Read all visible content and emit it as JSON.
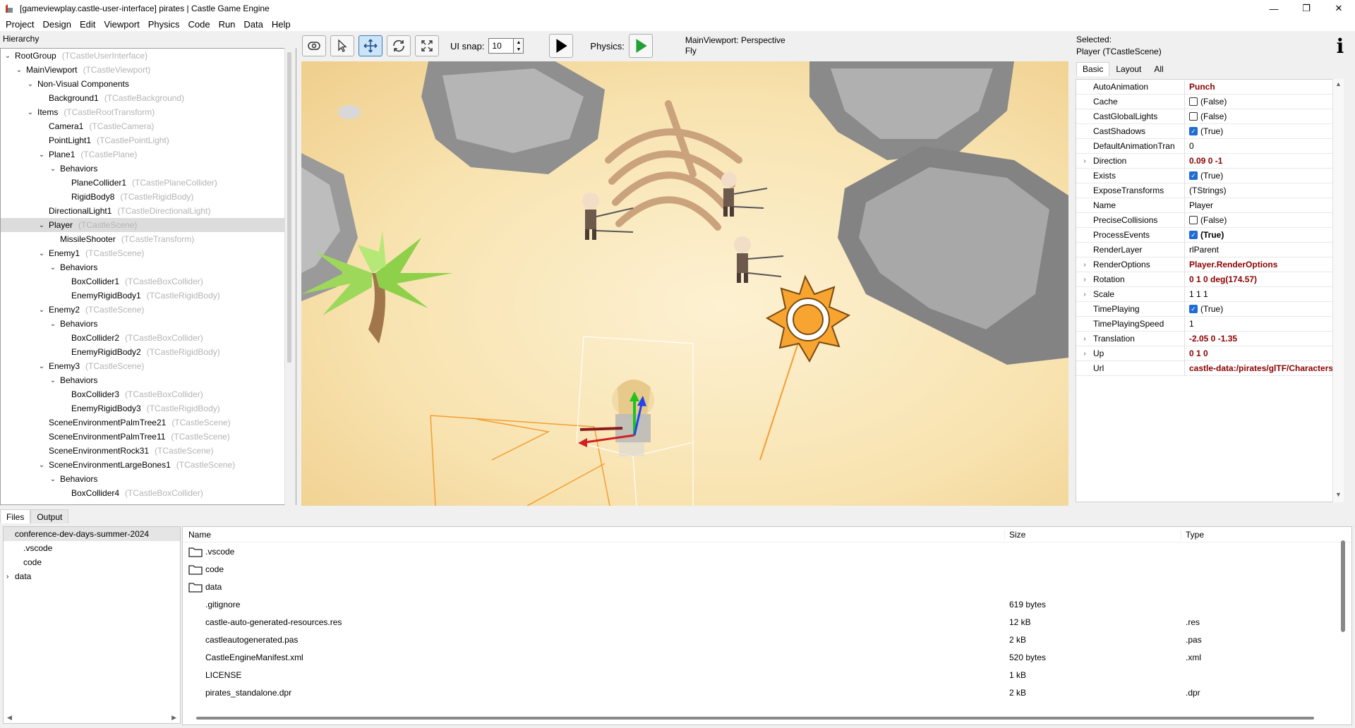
{
  "window": {
    "title": "[gameviewplay.castle-user-interface] pirates | Castle Game Engine",
    "controls": [
      "—",
      "❐",
      "✕"
    ]
  },
  "menu": [
    "Project",
    "Design",
    "Edit",
    "Viewport",
    "Physics",
    "Code",
    "Run",
    "Data",
    "Help"
  ],
  "hierarchy": {
    "label": "Hierarchy",
    "rows": [
      {
        "name": "RootGroup",
        "type": "(TCastleUserInterface)",
        "depth": 0,
        "toggle": "v"
      },
      {
        "name": "MainViewport",
        "type": "(TCastleViewport)",
        "depth": 1,
        "toggle": "v"
      },
      {
        "name": "Non-Visual Components",
        "type": "",
        "depth": 2,
        "toggle": "v"
      },
      {
        "name": "Background1",
        "type": "(TCastleBackground)",
        "depth": 3,
        "toggle": ""
      },
      {
        "name": "Items",
        "type": "(TCastleRootTransform)",
        "depth": 2,
        "toggle": "v"
      },
      {
        "name": "Camera1",
        "type": "(TCastleCamera)",
        "depth": 3,
        "toggle": ""
      },
      {
        "name": "PointLight1",
        "type": "(TCastlePointLight)",
        "depth": 3,
        "toggle": ""
      },
      {
        "name": "Plane1",
        "type": "(TCastlePlane)",
        "depth": 3,
        "toggle": "v"
      },
      {
        "name": "Behaviors",
        "type": "",
        "depth": 4,
        "toggle": "v"
      },
      {
        "name": "PlaneCollider1",
        "type": "(TCastlePlaneCollider)",
        "depth": 5,
        "toggle": ""
      },
      {
        "name": "RigidBody8",
        "type": "(TCastleRigidBody)",
        "depth": 5,
        "toggle": ""
      },
      {
        "name": "DirectionalLight1",
        "type": "(TCastleDirectionalLight)",
        "depth": 3,
        "toggle": ""
      },
      {
        "name": "Player",
        "type": "(TCastleScene)",
        "depth": 3,
        "toggle": "v",
        "selected": true
      },
      {
        "name": "MissileShooter",
        "type": "(TCastleTransform)",
        "depth": 4,
        "toggle": ""
      },
      {
        "name": "Enemy1",
        "type": "(TCastleScene)",
        "depth": 3,
        "toggle": "v"
      },
      {
        "name": "Behaviors",
        "type": "",
        "depth": 4,
        "toggle": "v"
      },
      {
        "name": "BoxCollider1",
        "type": "(TCastleBoxCollider)",
        "depth": 5,
        "toggle": ""
      },
      {
        "name": "EnemyRigidBody1",
        "type": "(TCastleRigidBody)",
        "depth": 5,
        "toggle": ""
      },
      {
        "name": "Enemy2",
        "type": "(TCastleScene)",
        "depth": 3,
        "toggle": "v"
      },
      {
        "name": "Behaviors",
        "type": "",
        "depth": 4,
        "toggle": "v"
      },
      {
        "name": "BoxCollider2",
        "type": "(TCastleBoxCollider)",
        "depth": 5,
        "toggle": ""
      },
      {
        "name": "EnemyRigidBody2",
        "type": "(TCastleRigidBody)",
        "depth": 5,
        "toggle": ""
      },
      {
        "name": "Enemy3",
        "type": "(TCastleScene)",
        "depth": 3,
        "toggle": "v"
      },
      {
        "name": "Behaviors",
        "type": "",
        "depth": 4,
        "toggle": "v"
      },
      {
        "name": "BoxCollider3",
        "type": "(TCastleBoxCollider)",
        "depth": 5,
        "toggle": ""
      },
      {
        "name": "EnemyRigidBody3",
        "type": "(TCastleRigidBody)",
        "depth": 5,
        "toggle": ""
      },
      {
        "name": "SceneEnvironmentPalmTree21",
        "type": "(TCastleScene)",
        "depth": 3,
        "toggle": ""
      },
      {
        "name": "SceneEnvironmentPalmTree11",
        "type": "(TCastleScene)",
        "depth": 3,
        "toggle": ""
      },
      {
        "name": "SceneEnvironmentRock31",
        "type": "(TCastleScene)",
        "depth": 3,
        "toggle": ""
      },
      {
        "name": "SceneEnvironmentLargeBones1",
        "type": "(TCastleScene)",
        "depth": 3,
        "toggle": "v"
      },
      {
        "name": "Behaviors",
        "type": "",
        "depth": 4,
        "toggle": "v"
      },
      {
        "name": "BoxCollider4",
        "type": "(TCastleBoxCollider)",
        "depth": 5,
        "toggle": ""
      }
    ]
  },
  "toolbar": {
    "tools": [
      "interact-mode-icon",
      "select-mode-icon",
      "translate-mode-icon",
      "rotate-mode-icon",
      "scale-mode-icon"
    ],
    "active_tool": 2,
    "ui_snap_label": "UI snap:",
    "ui_snap_value": "10",
    "physics_label": "Physics:",
    "viewport_info_line1": "MainViewport: Perspective",
    "viewport_info_line2": "Fly"
  },
  "inspector": {
    "selected_label": "Selected:",
    "selected_value": "Player (TCastleScene)",
    "tabs": [
      "Basic",
      "Layout",
      "All"
    ],
    "active_tab": 0,
    "props": [
      {
        "name": "AutoAnimation",
        "value": "Punch",
        "style": "bold",
        "exp": false
      },
      {
        "name": "Cache",
        "value": "(False)",
        "check": false,
        "exp": false
      },
      {
        "name": "CastGlobalLights",
        "value": "(False)",
        "check": false,
        "exp": false
      },
      {
        "name": "CastShadows",
        "value": "(True)",
        "check": true,
        "exp": false
      },
      {
        "name": "DefaultAnimationTran",
        "value": "0",
        "exp": false
      },
      {
        "name": "Direction",
        "value": "0.09 0 -1",
        "style": "bold",
        "exp": true
      },
      {
        "name": "Exists",
        "value": "(True)",
        "check": true,
        "exp": false
      },
      {
        "name": "ExposeTransforms",
        "value": "(TStrings)",
        "exp": false
      },
      {
        "name": "Name",
        "value": "Player",
        "exp": false
      },
      {
        "name": "PreciseCollisions",
        "value": "(False)",
        "check": false,
        "exp": false
      },
      {
        "name": "ProcessEvents",
        "value": "(True)",
        "check": true,
        "style": "boldblack",
        "exp": false
      },
      {
        "name": "RenderLayer",
        "value": "rlParent",
        "exp": false
      },
      {
        "name": "RenderOptions",
        "value": "Player.RenderOptions",
        "style": "bold",
        "exp": true
      },
      {
        "name": "Rotation",
        "value": "0 1 0 deg(174.57)",
        "style": "bold",
        "exp": true
      },
      {
        "name": "Scale",
        "value": "1 1 1",
        "exp": true
      },
      {
        "name": "TimePlaying",
        "value": "(True)",
        "check": true,
        "exp": false
      },
      {
        "name": "TimePlayingSpeed",
        "value": "1",
        "exp": false
      },
      {
        "name": "Translation",
        "value": "-2.05 0 -1.35",
        "style": "bold",
        "exp": true
      },
      {
        "name": "Up",
        "value": "0 1 0",
        "style": "bold",
        "exp": true
      },
      {
        "name": "Url",
        "value": "castle-data:/pirates/glTF/Characters/",
        "style": "bold",
        "exp": false
      }
    ]
  },
  "bottom": {
    "tabs": [
      "Files",
      "Output"
    ],
    "active_tab": 0,
    "tree": [
      {
        "name": "conference-dev-days-summer-2024",
        "toggle": "",
        "selected": true,
        "indent": 0
      },
      {
        "name": ".vscode",
        "toggle": "",
        "indent": 1
      },
      {
        "name": "code",
        "toggle": "",
        "indent": 1
      },
      {
        "name": "data",
        "toggle": ">",
        "indent": 0
      }
    ],
    "columns": [
      "Name",
      "Size",
      "Type"
    ],
    "files": [
      {
        "name": ".vscode",
        "size": "",
        "type": "",
        "folder": true
      },
      {
        "name": "code",
        "size": "",
        "type": "",
        "folder": true
      },
      {
        "name": "data",
        "size": "",
        "type": "",
        "folder": true
      },
      {
        "name": ".gitignore",
        "size": "619 bytes",
        "type": "",
        "folder": false
      },
      {
        "name": "castle-auto-generated-resources.res",
        "size": "12 kB",
        "type": ".res",
        "folder": false
      },
      {
        "name": "castleautogenerated.pas",
        "size": "2 kB",
        "type": ".pas",
        "folder": false
      },
      {
        "name": "CastleEngineManifest.xml",
        "size": "520 bytes",
        "type": ".xml",
        "folder": false
      },
      {
        "name": "LICENSE",
        "size": "1 kB",
        "type": "",
        "folder": false
      },
      {
        "name": "pirates_standalone.dpr",
        "size": "2 kB",
        "type": ".dpr",
        "folder": false
      }
    ]
  },
  "colors": {
    "selection": "#dcdcdc",
    "accent": "#1f6dd1",
    "bold_value": "#8b0000",
    "play_green": "#22a033"
  }
}
